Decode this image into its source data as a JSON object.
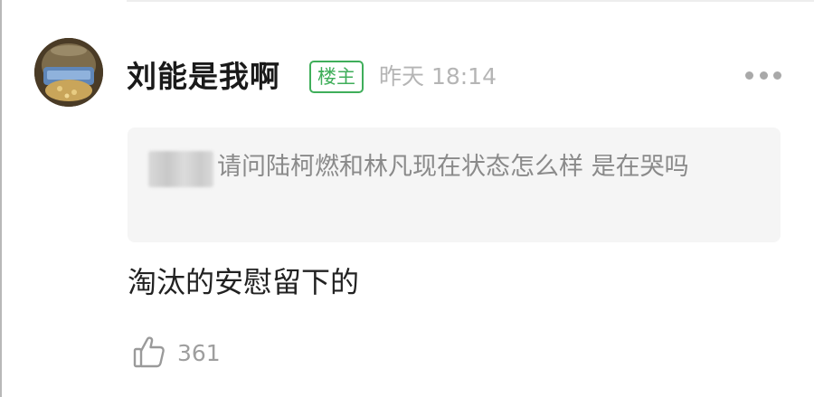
{
  "comment": {
    "author": {
      "name": "刘能是我啊",
      "badge": "楼主",
      "avatar_icon": "avatar-image"
    },
    "timestamp": "昨天 18:14",
    "more_icon": "more-dots-icon",
    "quote": {
      "text": "请问陆柯燃和林凡现在状态怎么样 是在哭吗"
    },
    "body": "淘汰的安慰留下的",
    "likes": {
      "icon": "thumbs-up-icon",
      "count": "361"
    }
  },
  "colors": {
    "badge_green": "#3fae5a",
    "timestamp_gray": "#b5b5b5",
    "quote_bg": "#f5f5f5",
    "quote_text": "#8a8a8a",
    "body_text": "#222222"
  }
}
